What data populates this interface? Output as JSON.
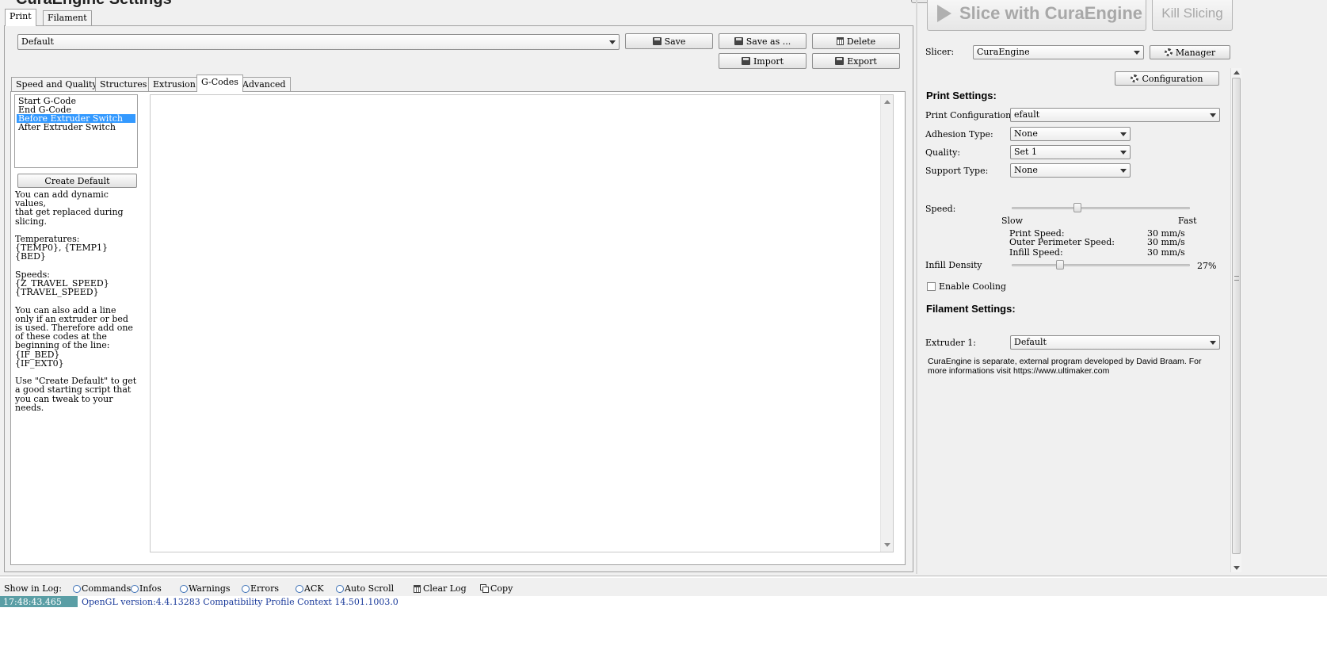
{
  "window": {
    "title": "CuraEngine Settings"
  },
  "top_tabs": [
    "Print",
    "Filament"
  ],
  "profile": {
    "selected": "Default"
  },
  "profile_buttons": {
    "save": "Save",
    "save_as": "Save as ...",
    "delete": "Delete",
    "import": "Import",
    "export": "Export"
  },
  "sub_tabs": [
    "Speed and Quality",
    "Structures",
    "Extrusion",
    "G-Codes",
    "Advanced"
  ],
  "gcode_list": [
    "Start G-Code",
    "End G-Code",
    "Before Extruder Switch",
    "After Extruder Switch"
  ],
  "gcode_selected_index": 2,
  "create_default_label": "Create Default",
  "help_text": "You can add dynamic values,\nthat get replaced during\nslicing.\n\nTemperatures:\n{TEMP0}, {TEMP1}\n{BED}\n\nSpeeds:\n{Z_TRAVEL_SPEED}\n{TRAVEL_SPEED}\n\nYou can also add a line\nonly if an extruder or bed\nis used. Therefore add one\nof these codes at the\nbeginning of the line:\n{IF_BED}\n{IF_EXT0}\n\nUse \"Create Default\" to get\na good starting script that\nyou can tweak to your\nneeds.",
  "right": {
    "slice_button": "Slice with CuraEngine",
    "kill_button": "Kill Slicing",
    "slicer_label": "Slicer:",
    "slicer_value": "CuraEngine",
    "manager_button": "Manager",
    "configuration_button": "Configuration",
    "print_settings_title": "Print Settings:",
    "print_config_label": "Print Configuration:",
    "print_config_value": "efault",
    "adhesion_label": "Adhesion Type:",
    "adhesion_value": "None",
    "quality_label": "Quality:",
    "quality_value": "Set 1",
    "support_label": "Support Type:",
    "support_value": "None",
    "speed_label": "Speed:",
    "speed_slow": "Slow",
    "speed_fast": "Fast",
    "speed_level": 0.37,
    "print_speed_label": "Print Speed:",
    "print_speed_value": "30 mm/s",
    "outer_speed_label": "Outer Perimeter Speed:",
    "outer_speed_value": "30 mm/s",
    "infill_speed_label": "Infill Speed:",
    "infill_speed_value": "30 mm/s",
    "infill_density_label": "Infill Density",
    "infill_density_value": "27%",
    "infill_density_level": 0.27,
    "cooling_label": "Enable Cooling",
    "filament_settings_title": "Filament Settings:",
    "extruder_label": "Extruder 1:",
    "extruder_value": "Default",
    "note": "CuraEngine is separate, external program developed by David Braam. For more informations visit https://www.ultimaker.com"
  },
  "log": {
    "show_label": "Show in Log:",
    "options": [
      "Commands",
      "Infos",
      "Warnings",
      "Errors",
      "ACK",
      "Auto Scroll"
    ],
    "clear_label": "Clear Log",
    "copy_label": "Copy",
    "entry_time": "17:48:43.465",
    "entry_text": "OpenGL version:4.4.13283 Compatibility Profile Context 14.501.1003.0"
  },
  "colors": {
    "selection": "#3399ff",
    "log_time_bg": "#5a9ea5",
    "log_text": "#1a3a9a"
  }
}
